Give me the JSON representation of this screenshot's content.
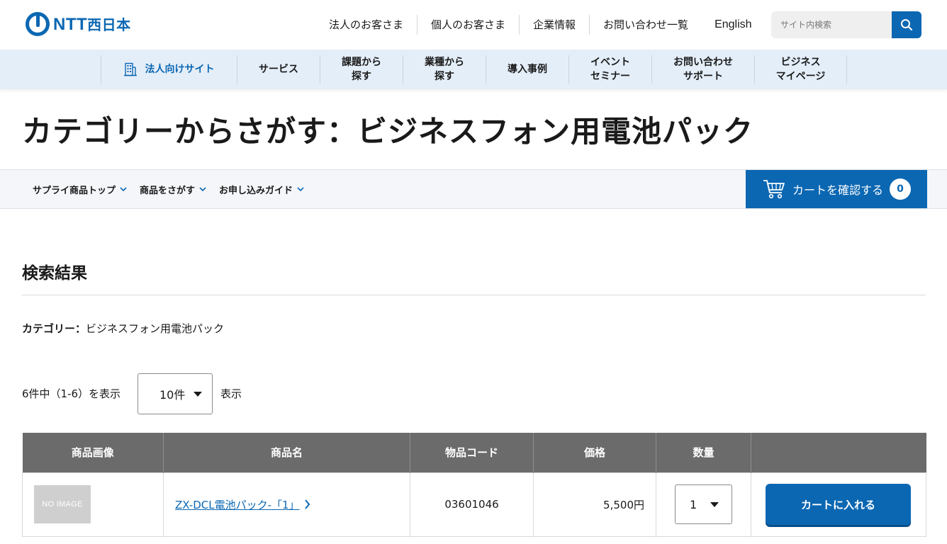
{
  "header": {
    "logo_main": "NTT",
    "logo_sub": "西日本",
    "nav": [
      "法人のお客さま",
      "個人のお客さま",
      "企業情報",
      "お問い合わせ一覧",
      "English"
    ],
    "search_placeholder": "サイト内検索"
  },
  "sub_nav": {
    "home": "法人向けサイト",
    "items": [
      "サービス",
      "課題から\n探す",
      "業種から\n探す",
      "導入事例",
      "イベント\nセミナー",
      "お問い合わせ\nサポート",
      "ビジネス\nマイページ"
    ]
  },
  "page_title": "カテゴリーからさがす：ビジネスフォン用電池パック",
  "secondary_nav": {
    "links": [
      "サプライ商品トップ",
      "商品をさがす",
      "お申し込みガイド"
    ],
    "cart_label": "カートを確認する",
    "cart_count": "0"
  },
  "results": {
    "heading": "検索結果",
    "category_label": "カテゴリー：",
    "category_value": "ビジネスフォン用電池パック",
    "count_text": "6件中（1-6）を表示",
    "per_page": "10件",
    "display_label": "表示",
    "columns": [
      "商品画像",
      "商品名",
      "物品コード",
      "価格",
      "数量",
      ""
    ],
    "rows": [
      {
        "image_text": "NO IMAGE",
        "name": "ZX-DCL電池パック-「1」",
        "code": "03601046",
        "price": "5,500円",
        "qty": "1",
        "button": "カートに入れる"
      }
    ]
  },
  "colors": {
    "brand_blue": "#0b67b2",
    "subnav_bg": "#e4eef9",
    "table_header": "#6b6b6b"
  }
}
